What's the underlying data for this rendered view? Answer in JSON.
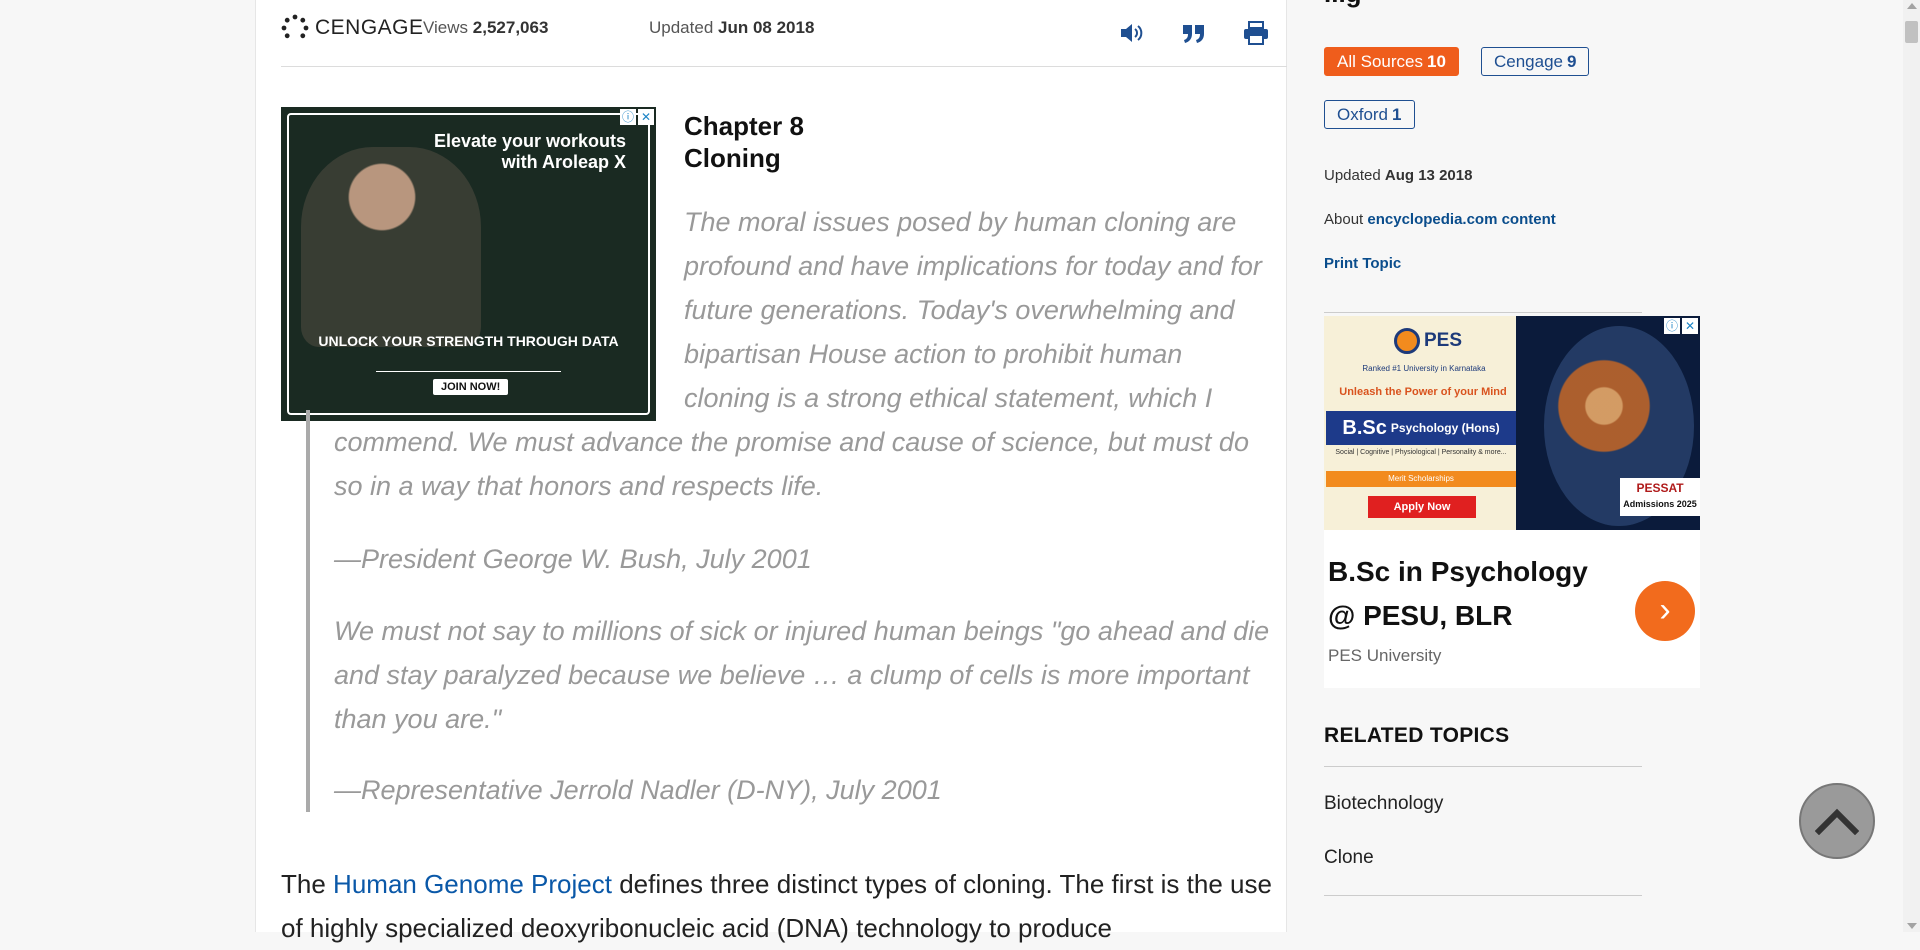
{
  "header": {
    "logo_text": "CENGAGE",
    "views_label": "Views",
    "views_value": "2,527,063",
    "updated_label": "Updated",
    "updated_value": "Jun 08 2018",
    "icons": [
      "speaker-icon",
      "quote-icon",
      "print-icon"
    ]
  },
  "left_ad": {
    "headline": "Elevate your workouts with Aroleap X",
    "subline": "UNLOCK YOUR STRENGTH THROUGH DATA",
    "cta": "JOIN NOW!"
  },
  "article": {
    "chapter": "Chapter 8",
    "chapter_title": "Cloning",
    "quote1_part1": "The moral issues posed by human cloning are profound and have implications for today and for future generations. Today's overwhelming and bipartisan House action to prohibit human cloning is a strong ethical statement, which I",
    "quote1_part2": "commend. We must advance the promise and cause of science, but must do so in a way that honors and respects life.",
    "quote1_attribution": "—President George W. Bush, July 2001",
    "quote2": "We must not say to millions of sick or injured human beings \"go ahead and die and stay paralyzed because we believe … a clump of cells is more important than you are.\"",
    "quote2_attribution": "—Representative Jerrold Nadler (D-NY), July 2001",
    "body_prefix": "The",
    "body_link": "Human Genome Project",
    "body_suffix": "defines three distinct types of cloning. The first is the use of highly specialized deoxyribonucleic acid (DNA) technology to produce"
  },
  "sidebar": {
    "heading_fragment": "...g",
    "sources": [
      {
        "label": "All Sources",
        "count": "10"
      },
      {
        "label": "Cengage",
        "count": "9"
      },
      {
        "label": "Oxford",
        "count": "1"
      }
    ],
    "updated_label": "Updated",
    "updated_value": "Aug 13 2018",
    "about_label": "About",
    "about_link": "encyclopedia.com content",
    "print_topic": "Print Topic",
    "ad": {
      "logo": "PES",
      "ranked": "Ranked #1 University in Karnataka",
      "unleash": "Unleash the Power of your Mind",
      "degree": "B.Sc",
      "degree_sub": "Psychology (Hons)",
      "tags": "Social | Cognitive | Physiological | Personality & more...",
      "merit": "Merit Scholarships",
      "apply": "Apply Now",
      "pessat": "PESSAT",
      "admissions": "Admissions 2025",
      "title": "B.Sc in Psychology @ PESU, BLR",
      "brand": "PES University"
    },
    "related_title": "RELATED TOPICS",
    "related": [
      "Biotechnology",
      "Clone"
    ]
  },
  "colors": {
    "accent_orange": "#ef5d1c",
    "link_blue": "#0a58a8",
    "chip_blue": "#1f4f91"
  }
}
